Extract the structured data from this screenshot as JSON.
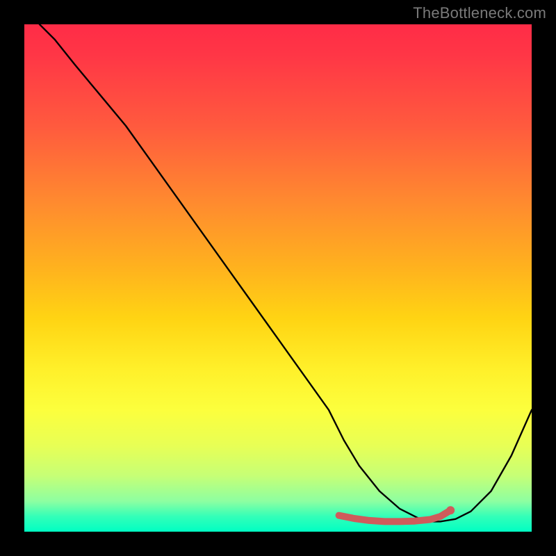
{
  "watermark": "TheBottleneck.com",
  "chart_data": {
    "type": "line",
    "title": "",
    "xlabel": "",
    "ylabel": "",
    "xlim": [
      0,
      100
    ],
    "ylim": [
      0,
      100
    ],
    "grid": false,
    "series": [
      {
        "name": "curve",
        "color": "#000000",
        "x": [
          3,
          6,
          10,
          15,
          20,
          25,
          30,
          35,
          40,
          45,
          50,
          55,
          60,
          63,
          66,
          70,
          74,
          78,
          80,
          82,
          85,
          88,
          92,
          96,
          100
        ],
        "values": [
          100,
          97,
          92,
          86,
          80,
          73,
          66,
          59,
          52,
          45,
          38,
          31,
          24,
          18,
          13,
          8,
          4.5,
          2.5,
          2,
          2,
          2.5,
          4,
          8,
          15,
          24
        ]
      }
    ],
    "highlight_band": {
      "color": "#d06060",
      "x": [
        62,
        65,
        68,
        71,
        74,
        77,
        80,
        82,
        84
      ],
      "values": [
        3.2,
        2.6,
        2.2,
        2.0,
        2.0,
        2.1,
        2.4,
        3.0,
        4.2
      ]
    },
    "background_gradient": {
      "from": "#ff2c47",
      "through": [
        "#ffb21e",
        "#fcff3d"
      ],
      "to": "#00ffc3"
    }
  }
}
